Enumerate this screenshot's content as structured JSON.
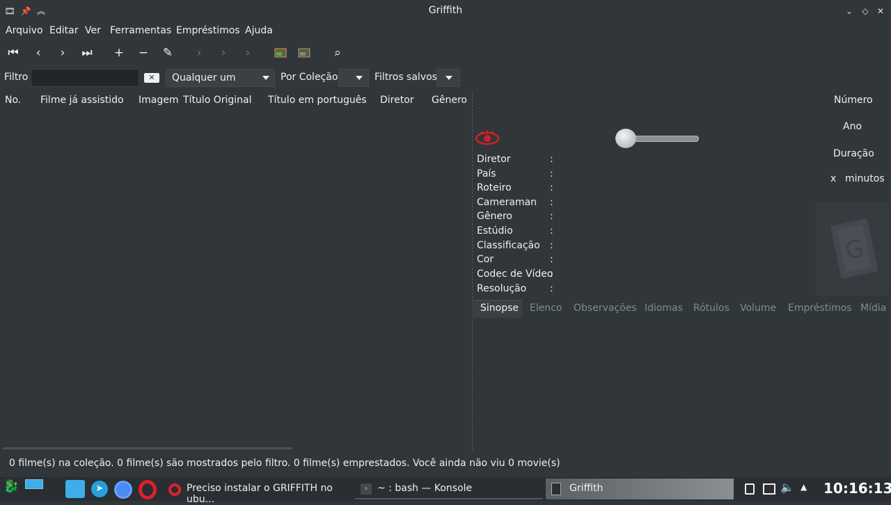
{
  "window": {
    "title": "Griffith"
  },
  "menu": [
    "Arquivo",
    "Editar",
    "Ver",
    "Ferramentas",
    "Empréstimos",
    "Ajuda"
  ],
  "filter": {
    "label": "Filtro",
    "value": "",
    "combo1": "Qualquer um",
    "collection_label": "Por Coleção",
    "saved_label": "Filtros salvos"
  },
  "columns": [
    "No.",
    "Filme já assistido",
    "Imagem",
    "Título Original",
    "Título em português",
    "Diretor",
    "Gênero"
  ],
  "details": {
    "labels": [
      "Diretor",
      "País",
      "Roteiro",
      "Cameraman",
      "Gênero",
      "Estúdio",
      "Classificação",
      "Cor",
      "Codec de Vídeo",
      "Resolução"
    ],
    "colon": ":",
    "right": {
      "numero": "Número",
      "ano": "Ano",
      "duracao": "Duração",
      "x": "x",
      "minutos": "minutos"
    }
  },
  "tabs": [
    "Sinopse",
    "Elenco",
    "Observações",
    "Idiomas",
    "Rótulos",
    "Volume",
    "Empréstimos",
    "Mídia"
  ],
  "status": "0 filme(s) na coleção. 0 filme(s) são mostrados pelo filtro. 0 filme(s) emprestados. Você ainda não viu 0 movie(s)",
  "taskbar": {
    "tasks": [
      "Preciso instalar o GRIFFITH no ubu...",
      "~ : bash — Konsole",
      "Griffith"
    ],
    "clock": "10:16:13"
  },
  "colors": {
    "bg": "#31363b",
    "taskbar": "#2a2e32",
    "accent": "#3daee9",
    "opera": "#e0202a"
  }
}
